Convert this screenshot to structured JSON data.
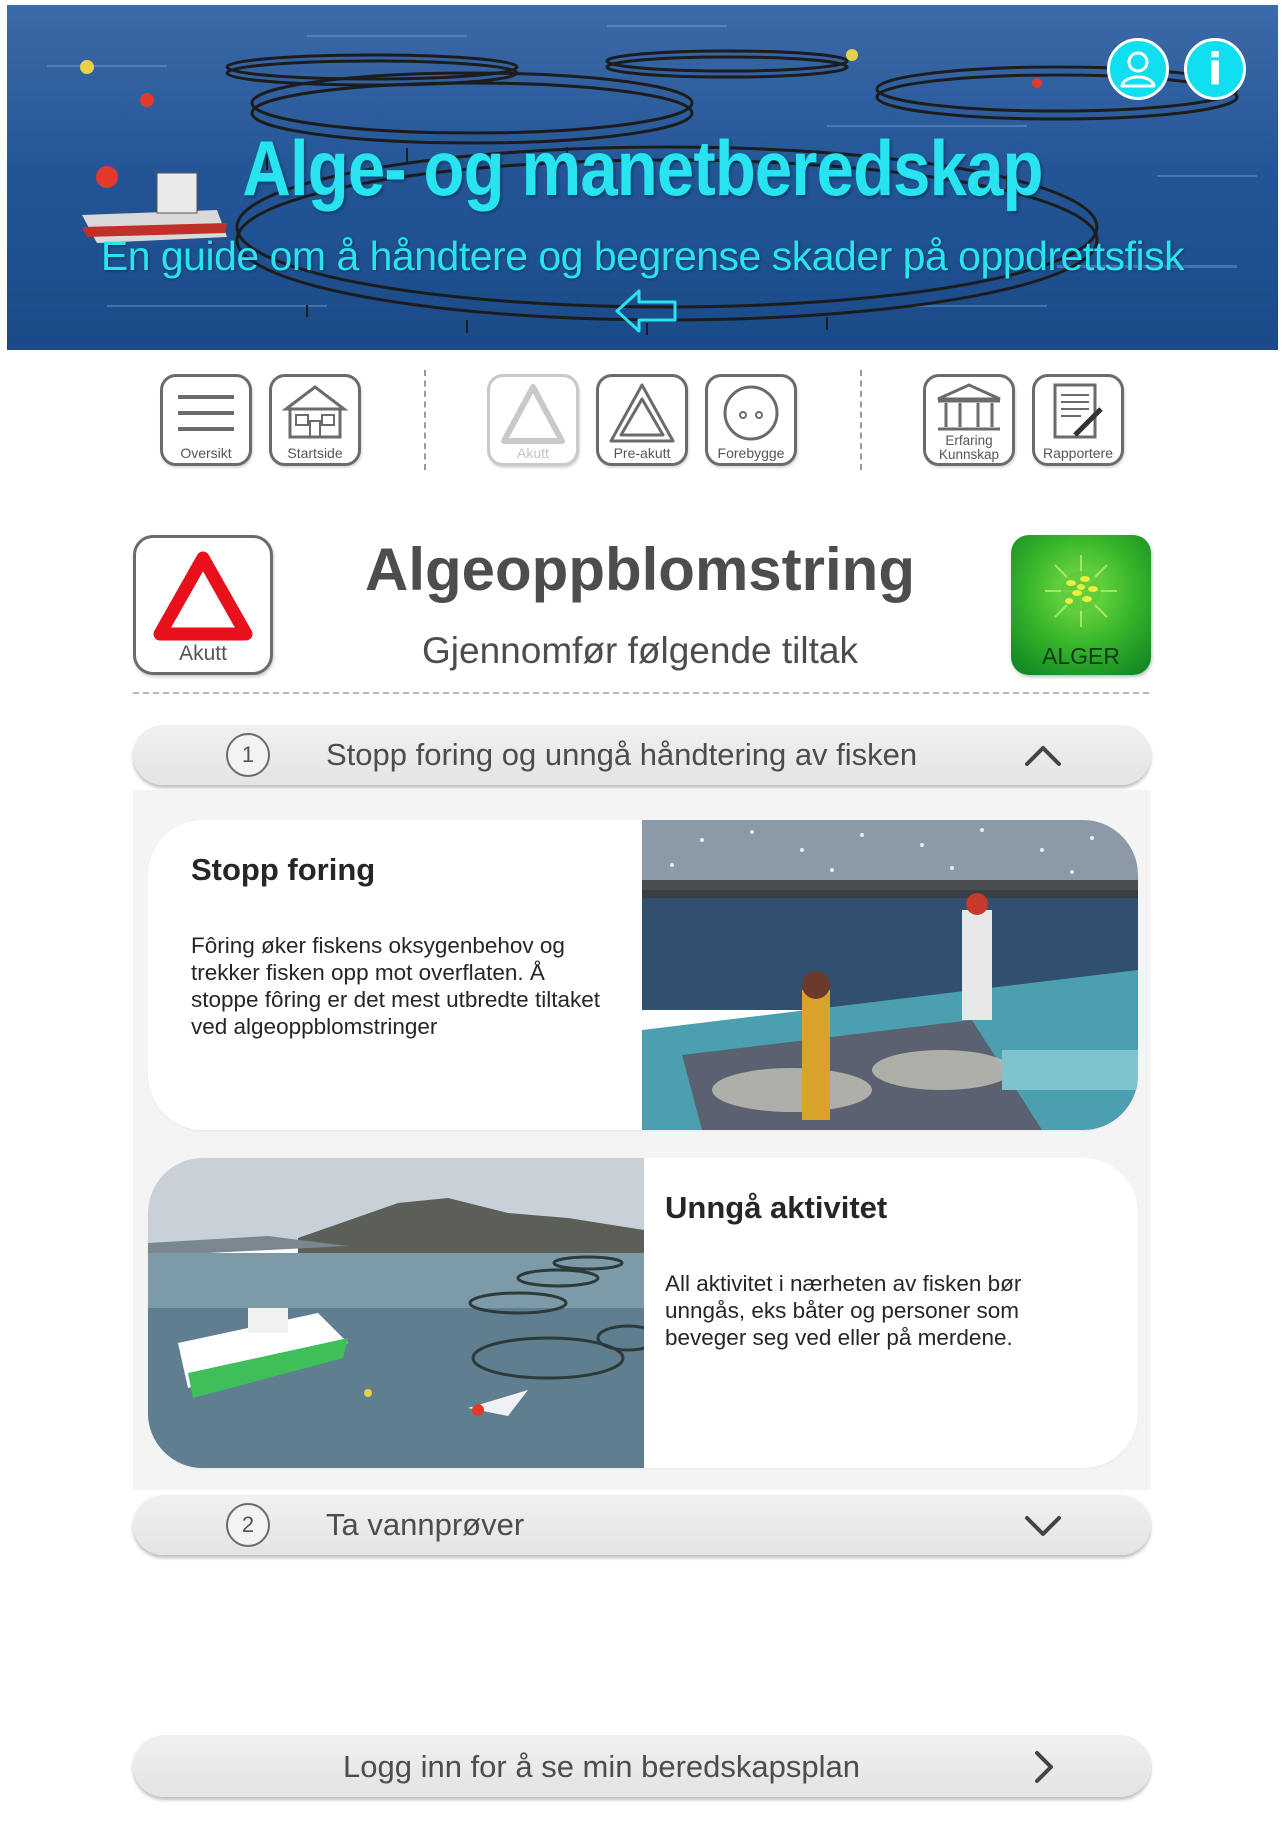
{
  "hero": {
    "title": "Alge- og manetberedskap",
    "subtitle": "En guide om å håndtere og begrense skader på oppdrettsfisk",
    "back_icon": "arrow-left-icon",
    "user_icon": "user-icon",
    "info_label": "i",
    "accent_color": "#27e4f0"
  },
  "toolbar": {
    "items": [
      {
        "label": "Oversikt",
        "icon": "menu-icon",
        "enabled": true
      },
      {
        "label": "Startside",
        "icon": "home-icon",
        "enabled": true
      },
      {
        "label": "Akutt",
        "icon": "warning-triangle-icon",
        "enabled": false
      },
      {
        "label": "Pre-akutt",
        "icon": "pre-warning-triangle-icon",
        "enabled": true
      },
      {
        "label": "Forebygge",
        "icon": "face-icon",
        "enabled": true
      },
      {
        "label": "Erfaring Kunnskap",
        "label_line1": "Erfaring",
        "label_line2": "Kunnskap",
        "icon": "building-icon",
        "enabled": true
      },
      {
        "label": "Rapportere",
        "icon": "document-pen-icon",
        "enabled": true
      }
    ]
  },
  "header": {
    "level_label": "Akutt",
    "level_color": "#e8101a",
    "title": "Algeoppblomstring",
    "subtitle": "Gjennomfør følgende tiltak",
    "badge_label": "ALGER",
    "badge_color": "#37b52a"
  },
  "steps": [
    {
      "number": "1",
      "title": "Stopp foring og unngå håndtering av fisken",
      "expanded": true,
      "cards": [
        {
          "title": "Stopp foring",
          "lines": [
            "Fôring øker fiskens oksygenbehov og",
            "trekker fisken opp mot overflaten. Å",
            "stoppe fôring er det mest utbredte tiltaket",
            "ved algeoppblomstringer"
          ],
          "image": "fishermen-boat-photo"
        },
        {
          "title": "Unngå aktivitet",
          "lines": [
            "All aktivitet i nærheten av fisken bør",
            "unngås, eks båter og personer som",
            "beveger seg ved eller på merdene."
          ],
          "image": "fish-farm-fjord-photo"
        }
      ]
    },
    {
      "number": "2",
      "title": "Ta vannprøver",
      "expanded": false
    }
  ],
  "login": {
    "label": "Logg inn for å se min beredskapsplan"
  }
}
